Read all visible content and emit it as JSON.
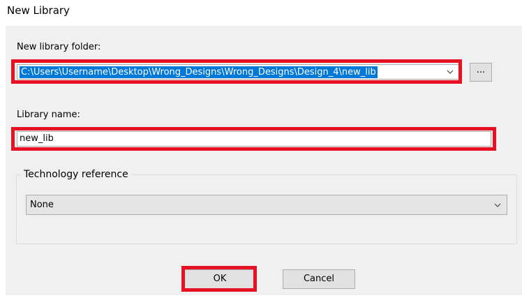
{
  "dialog": {
    "title": "New Library"
  },
  "folder": {
    "label": "New library folder:",
    "value": "C:\\Users\\Username\\Desktop\\Wrong_Designs\\Wrong_Designs\\Design_4\\new_lib",
    "browse_label": "..."
  },
  "library_name": {
    "label": "Library name:",
    "value": "new_lib"
  },
  "technology": {
    "legend": "Technology reference",
    "selected": "None"
  },
  "buttons": {
    "ok": "OK",
    "cancel": "Cancel"
  },
  "colors": {
    "highlight_box": "#e81123",
    "selection": "#0078d7",
    "panel": "#f0f0f0"
  },
  "icons": {
    "dropdown": "chevron-down-icon"
  }
}
